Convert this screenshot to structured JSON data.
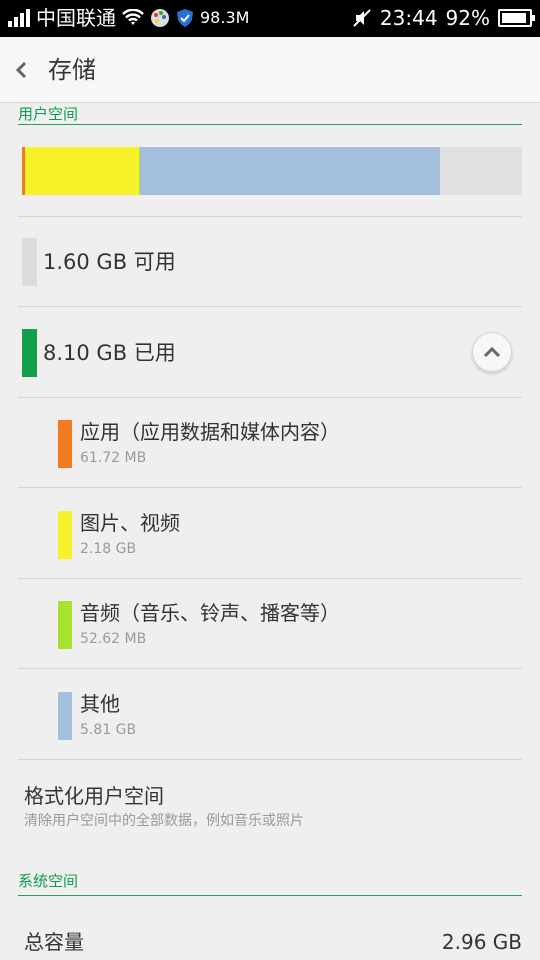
{
  "status_bar": {
    "carrier": "中国联通",
    "speed": "98.3M",
    "time": "23:44",
    "battery": "92%",
    "icons": [
      "signal-icon",
      "wifi-icon",
      "palette-icon",
      "shield-icon",
      "mute-icon",
      "battery-icon"
    ]
  },
  "header": {
    "title": "存储",
    "back_icon": "chevron-left-icon"
  },
  "user_space": {
    "section_label": "用户空间",
    "usage_bar": [
      {
        "name": "应用",
        "color": "#f47a1f",
        "fraction": 0.006
      },
      {
        "name": "图片、视频",
        "color": "#f8f22b",
        "fraction": 0.229
      },
      {
        "name": "音频",
        "color": "#a6e22e",
        "fraction": 0.002
      },
      {
        "name": "其他",
        "color": "#a4bfdc",
        "fraction": 0.6
      },
      {
        "name": "可用",
        "color": "#e0e0e0",
        "fraction": 0.165
      }
    ],
    "available": {
      "label": "1.60 GB 可用",
      "color": "#dcdcdc"
    },
    "used": {
      "label": "8.10 GB 已用",
      "color": "#12a04a",
      "toggle_icon": "chevron-up-icon"
    },
    "categories": [
      {
        "label": "应用（应用数据和媒体内容）",
        "size": "61.72 MB",
        "color": "#f47a1f"
      },
      {
        "label": "图片、视频",
        "size": "2.18 GB",
        "color": "#f8f22b"
      },
      {
        "label": "音频（音乐、铃声、播客等）",
        "size": "52.62 MB",
        "color": "#a6e22e"
      },
      {
        "label": "其他",
        "size": "5.81 GB",
        "color": "#a4bfdc"
      }
    ]
  },
  "format": {
    "title": "格式化用户空间",
    "description": "清除用户空间中的全部数据，例如音乐或照片"
  },
  "system_space": {
    "section_label": "系统空间",
    "total_label": "总容量",
    "total_value": "2.96 GB"
  }
}
